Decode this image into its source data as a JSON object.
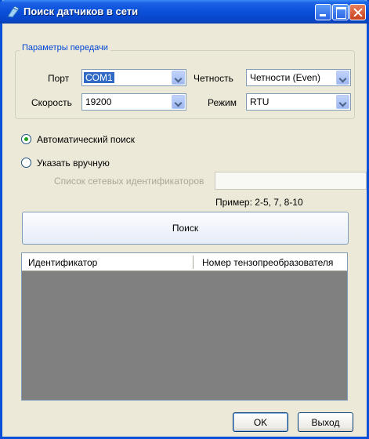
{
  "window": {
    "title": "Поиск датчиков в сети",
    "titlebar_color": "#0a4fd8",
    "icons": [
      "sensor-app-icon",
      "minimize-icon",
      "maximize-icon",
      "close-icon"
    ]
  },
  "transfer_params": {
    "legend": "Параметры передачи",
    "port": {
      "label": "Порт",
      "value": "COM1"
    },
    "baud": {
      "label": "Скорость",
      "value": "19200"
    },
    "parity": {
      "label": "Четность",
      "value": "Четности (Even)"
    },
    "mode": {
      "label": "Режим",
      "value": "RTU"
    }
  },
  "search_mode": {
    "auto_label": "Автоматический поиск",
    "manual_label": "Указать вручную",
    "selected": "auto",
    "id_list_label": "Список сетевых идентификаторов",
    "id_list_value": "",
    "example_text": "Пример: 2-5, 7, 8-10"
  },
  "search_button_label": "Поиск",
  "results_table": {
    "columns": [
      "Идентификатор",
      "Номер тензопреобразователя"
    ],
    "rows": []
  },
  "footer": {
    "ok_label": "OK",
    "exit_label": "Выход"
  }
}
